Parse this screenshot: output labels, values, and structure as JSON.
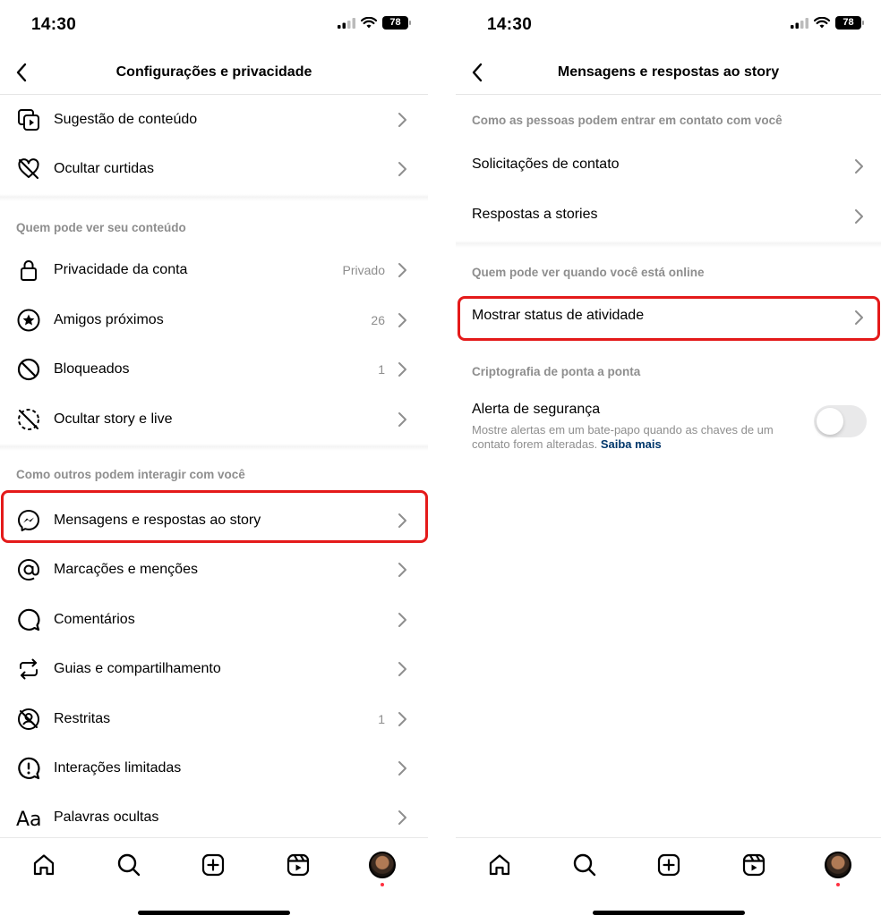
{
  "status_bar": {
    "time": "14:30",
    "battery": "78"
  },
  "left_screen": {
    "title": "Configurações e privacidade",
    "top_items": [
      {
        "label": "Sugestão de conteúdo",
        "icon": "suggested-content-icon"
      },
      {
        "label": "Ocultar curtidas",
        "icon": "hidden-like-icon"
      }
    ],
    "section_visibility": {
      "title": "Quem pode ver seu conteúdo",
      "items": [
        {
          "label": "Privacidade da conta",
          "value": "Privado",
          "icon": "lock-icon"
        },
        {
          "label": "Amigos próximos",
          "value": "26",
          "icon": "star-icon"
        },
        {
          "label": "Bloqueados",
          "value": "1",
          "icon": "blocked-icon"
        },
        {
          "label": "Ocultar story e live",
          "value": "",
          "icon": "hide-story-icon"
        }
      ]
    },
    "section_interaction": {
      "title": "Como outros podem interagir com você",
      "items": [
        {
          "label": "Mensagens e respostas ao story",
          "value": "",
          "icon": "messenger-icon"
        },
        {
          "label": "Marcações e menções",
          "value": "",
          "icon": "at-sign-icon"
        },
        {
          "label": "Comentários",
          "value": "",
          "icon": "comment-icon"
        },
        {
          "label": "Guias e compartilhamento",
          "value": "",
          "icon": "share-icon"
        },
        {
          "label": "Restritas",
          "value": "1",
          "icon": "restricted-icon"
        },
        {
          "label": "Interações limitadas",
          "value": "",
          "icon": "limited-icon"
        },
        {
          "label": "Palavras ocultas",
          "value": "",
          "icon": "text-aa-icon"
        }
      ]
    }
  },
  "right_screen": {
    "title": "Mensagens e respostas ao story",
    "section_contact": {
      "title": "Como as pessoas podem entrar em contato com você",
      "items": [
        {
          "label": "Solicitações de contato"
        },
        {
          "label": "Respostas a stories"
        }
      ]
    },
    "section_online": {
      "title": "Quem pode ver quando você está online",
      "items": [
        {
          "label": "Mostrar status de atividade"
        }
      ]
    },
    "section_encryption": {
      "title": "Criptografia de ponta a ponta",
      "toggle": {
        "title": "Alerta de segurança",
        "description": "Mostre alertas em um bate-papo quando as chaves de um contato forem alteradas.",
        "link": "Saiba mais",
        "on": false
      }
    }
  },
  "tab_bar": [
    "home-icon",
    "search-icon",
    "create-icon",
    "reels-icon",
    "profile-avatar"
  ],
  "colors": {
    "highlight": "#e41a1a",
    "secondary_text": "#8e8e8e",
    "link": "#00376b",
    "notification_dot": "#ff3040"
  }
}
